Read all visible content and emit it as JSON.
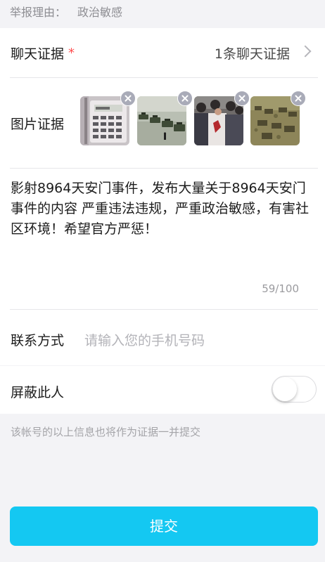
{
  "reason": {
    "label": "举报理由：",
    "value": "政治敏感"
  },
  "chat_evidence": {
    "label": "聊天证据",
    "required_mark": "*",
    "value": "1条聊天证据"
  },
  "image_evidence": {
    "label": "图片证据",
    "images": [
      {
        "name": "calculator-photo"
      },
      {
        "name": "tanks-street-photo"
      },
      {
        "name": "crowd-photo"
      },
      {
        "name": "tanks-square-photo"
      }
    ]
  },
  "description": {
    "text": "影射8964天安门事件，发布大量关于8964天安门事件的内容 严重违法违规，严重政治敏感，有害社区环境！希望官方严惩！",
    "counter": "59/100"
  },
  "contact": {
    "label": "联系方式",
    "placeholder": "请输入您的手机号码"
  },
  "block_user": {
    "label": "屏蔽此人",
    "enabled": false
  },
  "note": "该帐号的以上信息也将作为证据一并提交",
  "submit_label": "提交",
  "colors": {
    "accent": "#14c8f2",
    "required": "#ff4d4f",
    "background": "#f3f3f6"
  }
}
